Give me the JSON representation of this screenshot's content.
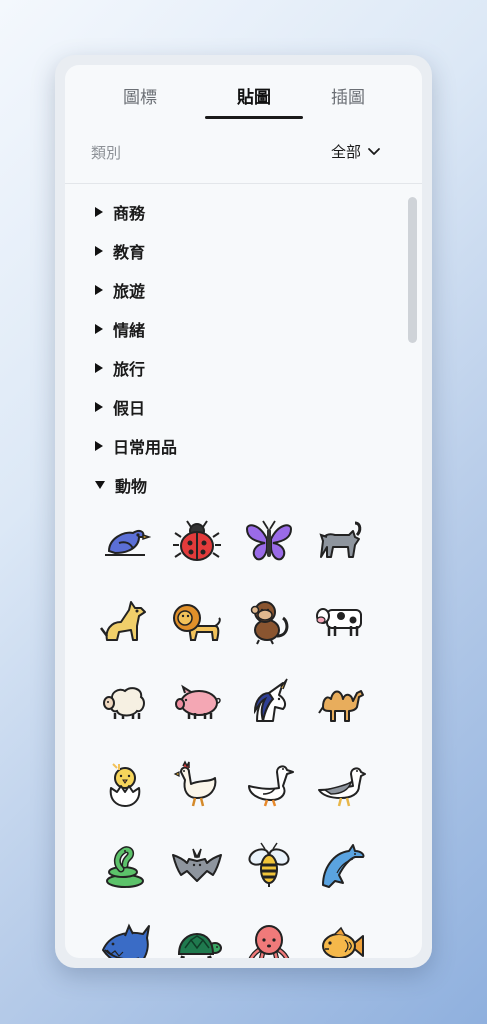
{
  "tabs": [
    {
      "label": "圖標",
      "active": false
    },
    {
      "label": "貼圖",
      "active": true
    },
    {
      "label": "插圖",
      "active": false
    }
  ],
  "filter": {
    "label": "類別",
    "value": "全部"
  },
  "categories": [
    {
      "label": "商務",
      "expanded": false
    },
    {
      "label": "教育",
      "expanded": false
    },
    {
      "label": "旅遊",
      "expanded": false
    },
    {
      "label": "情緒",
      "expanded": false
    },
    {
      "label": "旅行",
      "expanded": false
    },
    {
      "label": "假日",
      "expanded": false
    },
    {
      "label": "日常用品",
      "expanded": false
    },
    {
      "label": "動物",
      "expanded": true
    }
  ],
  "stickers": [
    "bird-sticker-icon",
    "ladybug-sticker-icon",
    "butterfly-sticker-icon",
    "cat-sticker-icon",
    "dog-sticker-icon",
    "lion-sticker-icon",
    "monkey-sticker-icon",
    "cow-sticker-icon",
    "sheep-sticker-icon",
    "pig-sticker-icon",
    "unicorn-sticker-icon",
    "camel-sticker-icon",
    "chick-sticker-icon",
    "hen-sticker-icon",
    "goose-sticker-icon",
    "seagull-sticker-icon",
    "snake-sticker-icon",
    "bat-sticker-icon",
    "bee-sticker-icon",
    "dolphin-sticker-icon",
    "shark-sticker-icon",
    "turtle-sticker-icon",
    "octopus-sticker-icon",
    "fish-sticker-icon"
  ]
}
